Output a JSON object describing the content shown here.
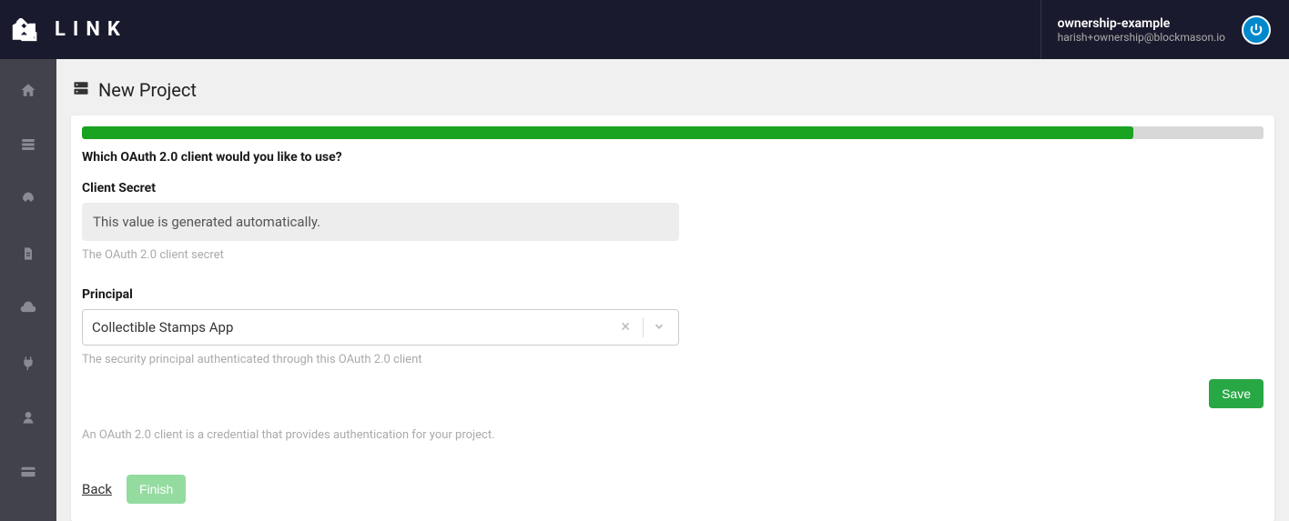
{
  "header": {
    "brand": "LINK",
    "user_name": "ownership-example",
    "user_email": "harish+ownership@blockmason.io"
  },
  "page": {
    "title": "New Project",
    "progress_percent": 89
  },
  "form": {
    "question": "Which OAuth 2.0 client would you like to use?",
    "client_secret": {
      "label": "Client Secret",
      "placeholder": "This value is generated automatically.",
      "help": "The OAuth 2.0 client secret"
    },
    "principal": {
      "label": "Principal",
      "value": "Collectible Stamps App",
      "help": "The security principal authenticated through this OAuth 2.0 client"
    },
    "footer_help": "An OAuth 2.0 client is a credential that provides authentication for your project.",
    "save_label": "Save",
    "back_label": "Back",
    "finish_label": "Finish"
  }
}
